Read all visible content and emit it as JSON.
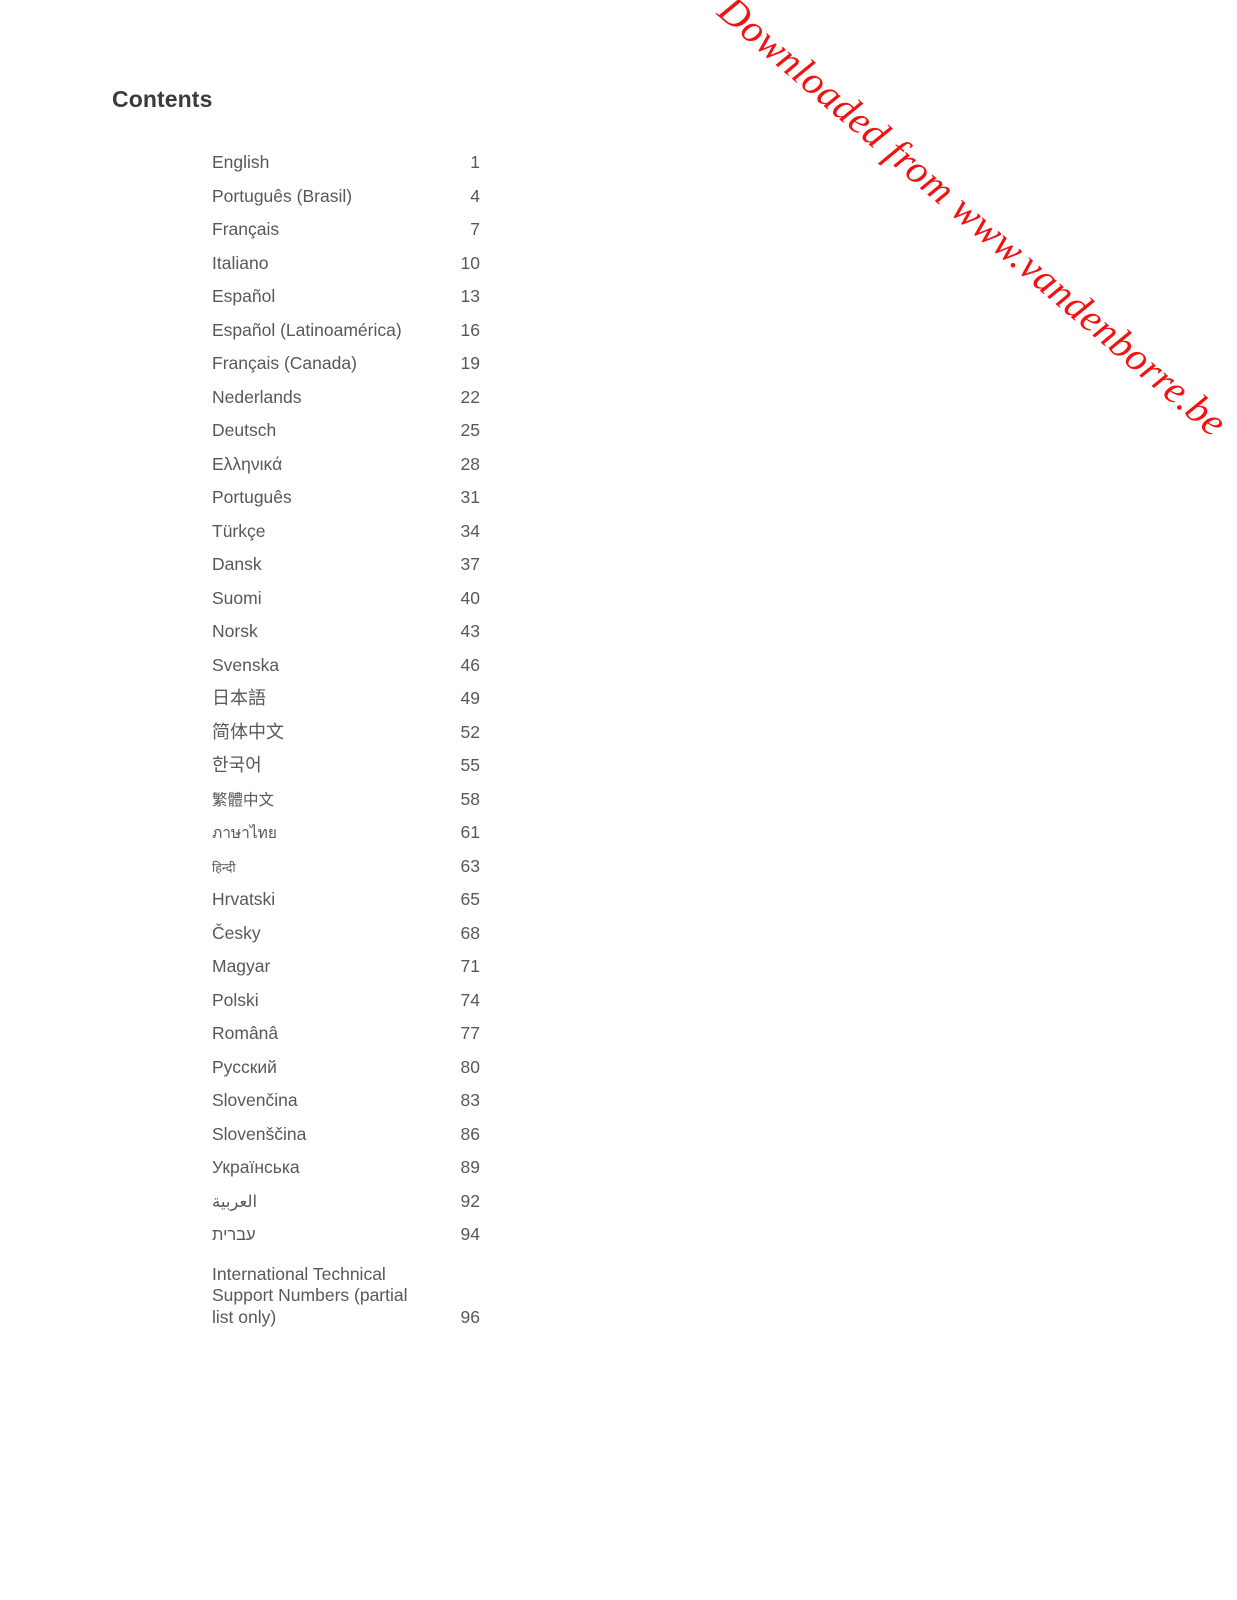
{
  "document": {
    "heading": "Contents",
    "text_color": "#58585a",
    "heading_color": "#3b3b3d"
  },
  "watermark": {
    "text": "Downloaded from www.vandenborre.be",
    "color": "#f41111",
    "rotation_deg": 40.5
  },
  "toc": {
    "entries": [
      {
        "label": "English",
        "page": "1",
        "script": "latin"
      },
      {
        "label": "Português (Brasil)",
        "page": "4",
        "script": "latin"
      },
      {
        "label": "Français",
        "page": "7",
        "script": "latin"
      },
      {
        "label": "Italiano",
        "page": "10",
        "script": "latin"
      },
      {
        "label": "Español",
        "page": "13",
        "script": "latin"
      },
      {
        "label": "Español (Latinoamérica)",
        "page": "16",
        "script": "latin"
      },
      {
        "label": "Français (Canada)",
        "page": "19",
        "script": "latin"
      },
      {
        "label": "Nederlands",
        "page": "22",
        "script": "latin"
      },
      {
        "label": "Deutsch",
        "page": "25",
        "script": "latin"
      },
      {
        "label": "Ελληνικά",
        "page": "28",
        "script": "greek"
      },
      {
        "label": "Português",
        "page": "31",
        "script": "latin"
      },
      {
        "label": "Türkçe",
        "page": "34",
        "script": "latin"
      },
      {
        "label": "Dansk",
        "page": "37",
        "script": "latin"
      },
      {
        "label": "Suomi",
        "page": "40",
        "script": "latin"
      },
      {
        "label": "Norsk",
        "page": "43",
        "script": "latin"
      },
      {
        "label": "Svenska",
        "page": "46",
        "script": "latin"
      },
      {
        "label": "日本語",
        "page": "49",
        "script": "cjk"
      },
      {
        "label": "简体中文",
        "page": "52",
        "script": "cjk"
      },
      {
        "label": "한국어",
        "page": "55",
        "script": "cjk"
      },
      {
        "label": "繁體中文",
        "page": "58",
        "script": "tc"
      },
      {
        "label": "ภาษาไทย",
        "page": "61",
        "script": "thai"
      },
      {
        "label": "हिन्दी",
        "page": "63",
        "script": "deva"
      },
      {
        "label": "Hrvatski",
        "page": "65",
        "script": "latin"
      },
      {
        "label": "Česky",
        "page": "68",
        "script": "latin"
      },
      {
        "label": "Magyar",
        "page": "71",
        "script": "latin"
      },
      {
        "label": "Polski",
        "page": "74",
        "script": "latin"
      },
      {
        "label": "Românâ",
        "page": "77",
        "script": "latin"
      },
      {
        "label": "Русский",
        "page": "80",
        "script": "cyrillic"
      },
      {
        "label": "Slovenčina",
        "page": "83",
        "script": "latin"
      },
      {
        "label": "Slovenščina",
        "page": "86",
        "script": "latin"
      },
      {
        "label": "Українська",
        "page": "89",
        "script": "cyrillic"
      },
      {
        "label": "العربية",
        "page": "92",
        "script": "rtl"
      },
      {
        "label": "עברית",
        "page": "94",
        "script": "rtl"
      },
      {
        "label": "International Technical Support Numbers (partial list only)",
        "page": "96",
        "script": "latin",
        "multiline": true
      }
    ]
  }
}
